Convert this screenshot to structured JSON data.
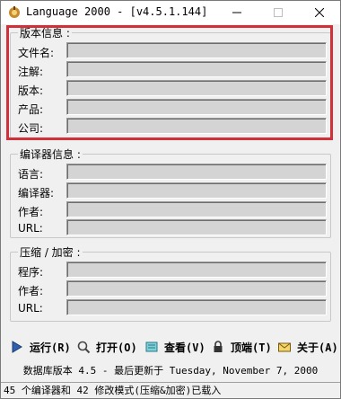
{
  "window": {
    "title": "Language 2000 - [v4.5.1.144]"
  },
  "version_group": {
    "legend": "版本信息 :",
    "rows": [
      {
        "label": "文件名:",
        "value": ""
      },
      {
        "label": "注解:",
        "value": ""
      },
      {
        "label": "版本:",
        "value": ""
      },
      {
        "label": "产品:",
        "value": ""
      },
      {
        "label": "公司:",
        "value": ""
      }
    ]
  },
  "compiler_group": {
    "legend": "编译器信息 :",
    "rows": [
      {
        "label": "语言:",
        "value": ""
      },
      {
        "label": "编译器:",
        "value": ""
      },
      {
        "label": "作者:",
        "value": ""
      },
      {
        "label": "URL:",
        "value": ""
      }
    ]
  },
  "packer_group": {
    "legend": "压缩 / 加密 :",
    "rows": [
      {
        "label": "程序:",
        "value": ""
      },
      {
        "label": "作者:",
        "value": ""
      },
      {
        "label": "URL:",
        "value": ""
      }
    ]
  },
  "toolbar": {
    "run": "运行(R)",
    "open": "打开(O)",
    "view": "查看(V)",
    "topmost": "顶端(T)",
    "about": "关于(A)"
  },
  "info_line": "数据库版本 4.5 - 最后更新于 Tuesday, November 7, 2000",
  "status": "45 个编译器和 42 修改模式(压缩&加密)已载入",
  "colors": {
    "highlight": "#d0303a",
    "field_bg": "#d4d4d4"
  }
}
